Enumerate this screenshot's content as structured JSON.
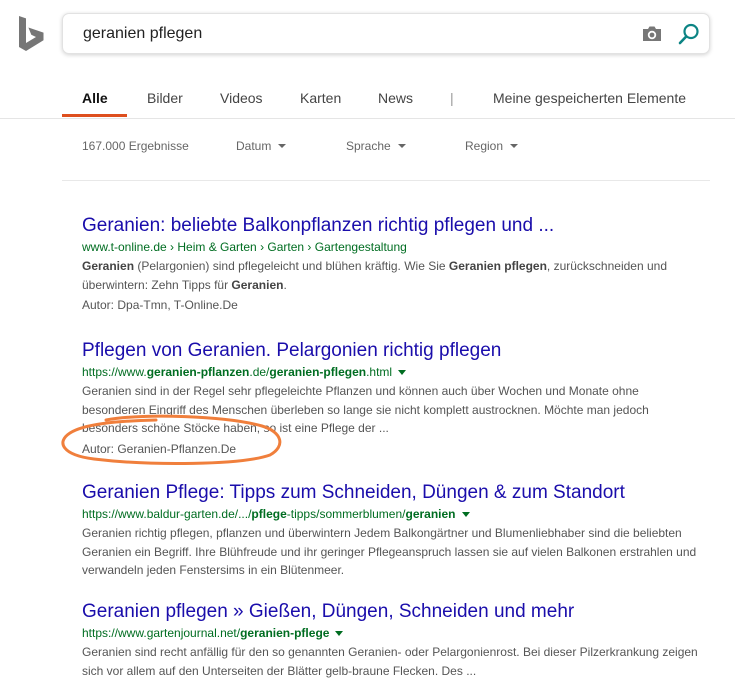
{
  "search": {
    "query": "geranien pflegen"
  },
  "tabs": [
    "Alle",
    "Bilder",
    "Videos",
    "Karten",
    "News",
    "|",
    "Meine gespeicherten Elemente"
  ],
  "filters": {
    "result_count": "167.000 Ergebnisse",
    "options": [
      "Datum",
      "Sprache",
      "Region"
    ]
  },
  "results": [
    {
      "title": "Geranien: beliebte Balkonpflanzen richtig pflegen und ...",
      "url": [
        {
          "t": "www.t-online.de › Heim & Garten › Garten › Gartengestaltung",
          "b": false
        }
      ],
      "has_url_menu": false,
      "snippet": [
        {
          "t": "Geranien",
          "b": true
        },
        {
          "t": " (Pelargonien) sind pflegeleicht und blühen kräftig. Wie Sie ",
          "b": false
        },
        {
          "t": "Geranien pflegen",
          "b": true
        },
        {
          "t": ", zurückschneiden und überwintern: Zehn Tipps für ",
          "b": false
        },
        {
          "t": "Geranien",
          "b": true
        },
        {
          "t": ".",
          "b": false
        }
      ],
      "author": "Autor: Dpa-Tmn, T-Online.De"
    },
    {
      "title": "Pflegen von Geranien. Pelargonien richtig pflegen",
      "url": [
        {
          "t": "https://www.",
          "b": false
        },
        {
          "t": "geranien-pflanzen",
          "b": true
        },
        {
          "t": ".de/",
          "b": false
        },
        {
          "t": "geranien-pflegen",
          "b": true
        },
        {
          "t": ".html",
          "b": false
        }
      ],
      "has_url_menu": true,
      "snippet": [
        {
          "t": "Geranien sind in der Regel sehr pflegeleichte Pflanzen und können auch über Wochen und Monate ohne besonderen Eingriff des Menschen überleben so lange sie nicht komplett austrocknen. Möchte man jedoch besonders schöne Stöcke haben, so ist eine Pflege der ...",
          "b": false
        }
      ],
      "author": "Autor: Geranien-Pflanzen.De"
    },
    {
      "title": "Geranien Pflege: Tipps zum Schneiden, Düngen & zum Standort",
      "url": [
        {
          "t": "https://www.baldur-garten.de/.../",
          "b": false
        },
        {
          "t": "pflege",
          "b": true
        },
        {
          "t": "-tipps/sommerblumen/",
          "b": false
        },
        {
          "t": "geranien",
          "b": true
        }
      ],
      "has_url_menu": true,
      "snippet": [
        {
          "t": "Geranien richtig pflegen, pflanzen und überwintern Jedem Balkongärtner und Blumenliebhaber sind die beliebten Geranien ein Begriff. Ihre Blühfreude und ihr geringer Pflegeanspruch lassen sie auf vielen Balkonen erstrahlen und verwandeln jeden Fenstersims in ein Blütenmeer.",
          "b": false
        }
      ],
      "author": ""
    },
    {
      "title": "Geranien pflegen » Gießen, Düngen, Schneiden und mehr",
      "url": [
        {
          "t": "https://www.gartenjournal.net/",
          "b": false
        },
        {
          "t": "geranien-pflege",
          "b": true
        }
      ],
      "has_url_menu": true,
      "snippet": [
        {
          "t": "Geranien sind recht anfällig für den so genannten Geranien- oder Pelargonienrost. Bei dieser Pilzerkrankung zeigen sich vor allem auf den Unterseiten der Blätter gelb-braune Flecken. Des ...",
          "b": false
        }
      ],
      "author": ""
    }
  ],
  "colors": {
    "accent": "#de4f1e",
    "link": "#1a0dab",
    "url": "#006d21",
    "logo": "#767676",
    "search_icon": "#0c8484",
    "annotation": "#f07f3c"
  },
  "icons": [
    "bing-logo",
    "camera-icon",
    "search-icon"
  ]
}
